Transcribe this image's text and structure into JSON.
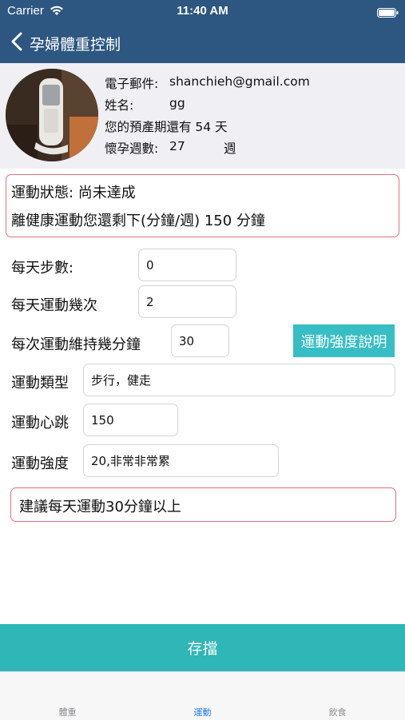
{
  "status": {
    "carrier": "Carrier",
    "time": "11:40 AM"
  },
  "nav": {
    "title": "孕婦體重控制"
  },
  "profile": {
    "email_label": "電子郵件:",
    "email_value": "shanchieh@gmail.com",
    "name_label": "姓名:",
    "name_value": "gg",
    "due_text": "您的預產期還有 54 天",
    "weeks_label": "懷孕週數:",
    "weeks_value": "27",
    "weeks_unit": "週"
  },
  "exercise_status": {
    "status_line": "運動狀態: 尚未達成",
    "remaining_line": "離健康運動您還剩下(分鐘/週) 150 分鐘"
  },
  "form": {
    "steps_label": "每天步數:",
    "steps_value": "0",
    "times_label": "每天運動幾次",
    "times_value": "2",
    "minutes_label": "每次運動維持幾分鐘",
    "minutes_value": "30",
    "intensity_info_button": "運動強度說明",
    "type_label": "運動類型",
    "type_value": "步行，健走",
    "heart_label": "運動心跳",
    "heart_value": "150",
    "intensity_label": "運動強度",
    "intensity_value": "20,非常非常累"
  },
  "suggestion": "建議每天運動30分鐘以上",
  "save_button": "存擋",
  "tabs": [
    {
      "label": "體重",
      "active": false
    },
    {
      "label": "運動",
      "active": true
    },
    {
      "label": "飲食",
      "active": false
    }
  ],
  "colors": {
    "nav_bg": "#2d5780",
    "accent_teal": "#2fb6b7",
    "alert_border": "#e0707d",
    "active_tab": "#1d7cf2"
  }
}
